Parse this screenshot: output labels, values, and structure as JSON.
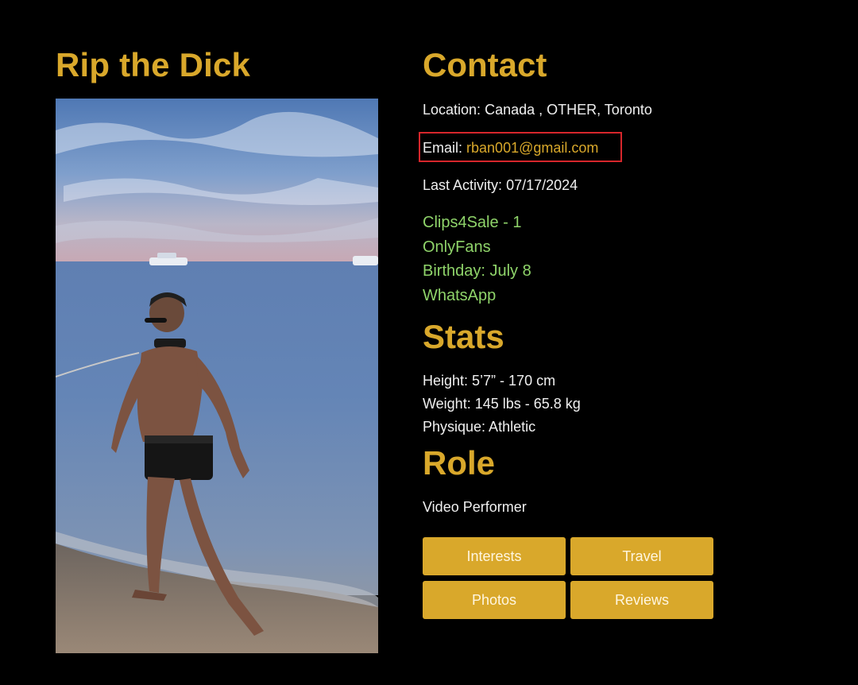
{
  "profile": {
    "name": "Rip the Dick",
    "photo_alt": "profile-photo"
  },
  "contact": {
    "title": "Contact",
    "location_label": "Location:",
    "location_value": "Canada , OTHER, Toronto",
    "email_label": "Email:",
    "email_value": "rban001@gmail.com",
    "last_activity_label": "Last Activity:",
    "last_activity_value": "07/17/2024",
    "links": [
      "Clips4Sale - 1",
      "OnlyFans",
      "Birthday: July 8",
      "WhatsApp"
    ]
  },
  "stats": {
    "title": "Stats",
    "height": "Height: 5’7” - 170 cm",
    "weight": "Weight: 145 lbs - 65.8 kg",
    "physique": "Physique: Athletic"
  },
  "role": {
    "title": "Role",
    "value": "Video Performer"
  },
  "buttons": {
    "interests": "Interests",
    "travel": "Travel",
    "photos": "Photos",
    "reviews": "Reviews"
  },
  "colors": {
    "accent": "#d9a82b",
    "link_green": "#8fd46a",
    "highlight_red": "#d6262b",
    "background": "#000000"
  }
}
